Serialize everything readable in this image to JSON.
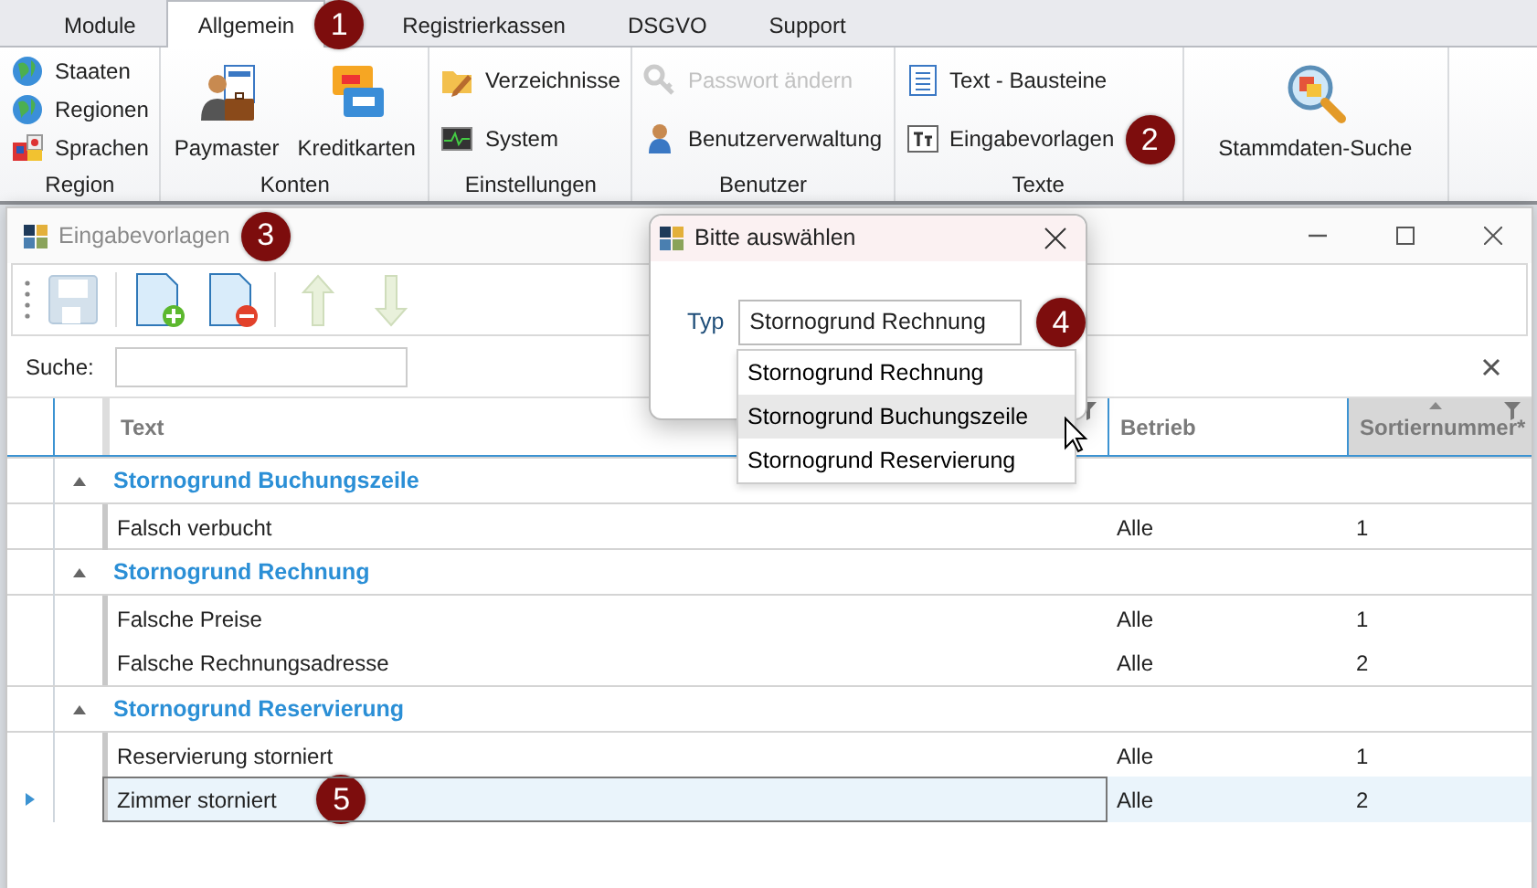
{
  "ribbon": {
    "tabs": [
      {
        "label": "Module",
        "selected": false
      },
      {
        "label": "Allgemein",
        "selected": true
      },
      {
        "label": "Registrierkassen",
        "selected": false
      },
      {
        "label": "DSGVO",
        "selected": false
      },
      {
        "label": "Support",
        "selected": false
      }
    ],
    "groups": [
      {
        "label": "Region",
        "items": [
          {
            "label": "Staaten",
            "kind": "small",
            "disabled": false
          },
          {
            "label": "Regionen",
            "kind": "small",
            "disabled": false
          },
          {
            "label": "Sprachen",
            "kind": "small",
            "disabled": false
          }
        ]
      },
      {
        "label": "Konten",
        "items": [
          {
            "label": "Paymaster",
            "kind": "large",
            "disabled": false
          },
          {
            "label": "Kreditkarten",
            "kind": "large",
            "disabled": false
          }
        ]
      },
      {
        "label": "Einstellungen",
        "items": [
          {
            "label": "Verzeichnisse",
            "kind": "small",
            "disabled": false
          },
          {
            "label": "System",
            "kind": "small",
            "disabled": false
          }
        ]
      },
      {
        "label": "Benutzer",
        "items": [
          {
            "label": "Passwort ändern",
            "kind": "small",
            "disabled": true
          },
          {
            "label": "Benutzerverwaltung",
            "kind": "small",
            "disabled": false
          }
        ]
      },
      {
        "label": "Texte",
        "items": [
          {
            "label": "Text - Bausteine",
            "kind": "small",
            "disabled": false
          },
          {
            "label": "Eingabevorlagen",
            "kind": "small",
            "disabled": false
          }
        ]
      },
      {
        "items": [
          {
            "label": "Stammdaten-Suche",
            "kind": "large",
            "disabled": false
          }
        ]
      }
    ]
  },
  "window": {
    "title": "Eingabevorlagen",
    "toolbar": [
      {
        "disabled": true
      },
      {
        "disabled": false
      },
      {
        "disabled": false
      },
      {
        "disabled": true
      },
      {
        "disabled": true
      }
    ],
    "search": {
      "label": "Suche:"
    },
    "table": {
      "columns": [
        {
          "label": "Text",
          "sorted": false,
          "filter": true
        },
        {
          "label": "Betrieb",
          "sorted": false,
          "filter": false
        },
        {
          "label": "Sortiernummer*",
          "sorted": true,
          "filter": true
        }
      ],
      "groups": [
        {
          "label": "Stornogrund Buchungszeile",
          "expanded": true,
          "rows": [
            {
              "cells": [
                "Falsch verbucht",
                "Alle",
                "1"
              ],
              "selected": false
            }
          ]
        },
        {
          "label": "Stornogrund Rechnung",
          "expanded": true,
          "rows": [
            {
              "cells": [
                "Falsche Preise",
                "Alle",
                "1"
              ],
              "selected": false
            },
            {
              "cells": [
                "Falsche Rechnungsadresse",
                "Alle",
                "2"
              ],
              "selected": false
            }
          ]
        },
        {
          "label": "Stornogrund Reservierung",
          "expanded": true,
          "rows": [
            {
              "cells": [
                "Reservierung storniert",
                "Alle",
                "1"
              ],
              "selected": false
            },
            {
              "cells": [
                "Zimmer storniert",
                "Alle",
                "2"
              ],
              "selected": true
            }
          ]
        }
      ]
    }
  },
  "dialog": {
    "title": "Bitte auswählen",
    "field_label": "Typ",
    "value": "Stornogrund Rechnung",
    "open": true,
    "options": [
      {
        "label": "Stornogrund Rechnung",
        "hovered": false
      },
      {
        "label": "Stornogrund Buchungszeile",
        "hovered": true
      },
      {
        "label": "Stornogrund Reservierung",
        "hovered": false
      }
    ]
  },
  "callouts": [
    {
      "label": "1"
    },
    {
      "label": "2"
    },
    {
      "label": "3"
    },
    {
      "label": "4"
    },
    {
      "label": "5"
    }
  ]
}
